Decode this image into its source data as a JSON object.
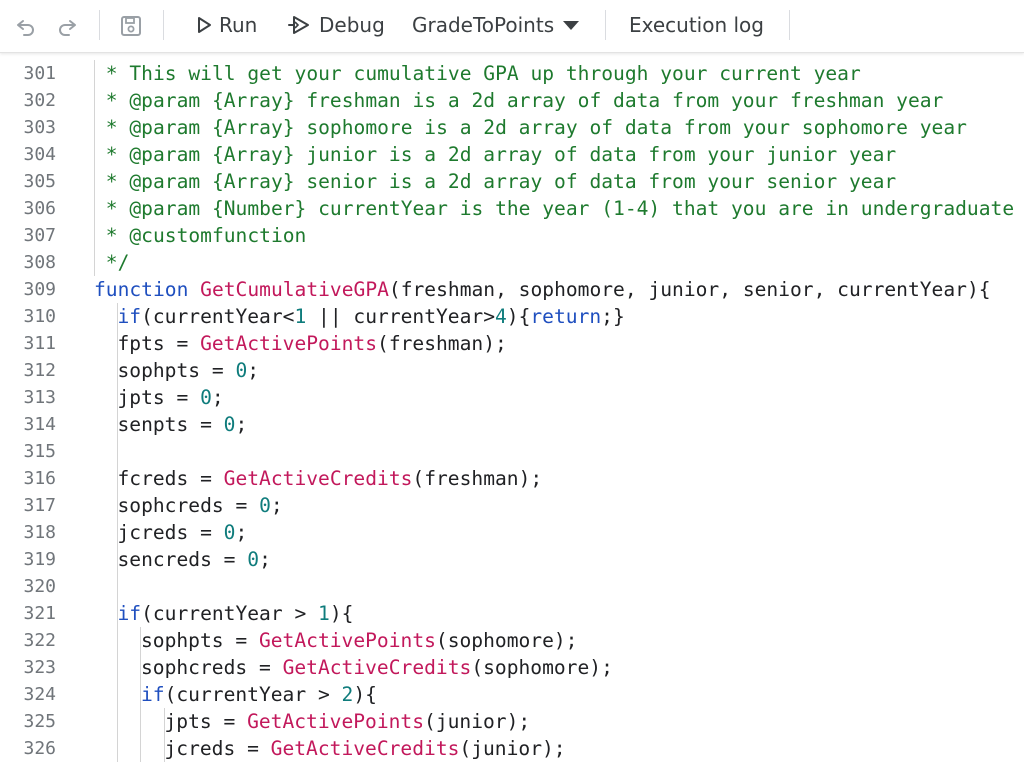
{
  "toolbar": {
    "undo_icon": "undo-icon",
    "redo_icon": "redo-icon",
    "save_icon": "save-icon",
    "run_label": "Run",
    "debug_label": "Debug",
    "function_select": "GradeToPoints",
    "execution_log_label": "Execution log"
  },
  "editor": {
    "lines": [
      {
        "n": "301",
        "indent": 0,
        "tokens": [
          {
            "t": " * This will get your cumulative GPA up through your current year",
            "c": "cmt"
          }
        ]
      },
      {
        "n": "302",
        "indent": 0,
        "tokens": [
          {
            "t": " * @param {Array} freshman is a 2d array of data from your freshman year",
            "c": "cmt"
          }
        ]
      },
      {
        "n": "303",
        "indent": 0,
        "tokens": [
          {
            "t": " * @param {Array} sophomore is a 2d array of data from your sophomore year",
            "c": "cmt"
          }
        ]
      },
      {
        "n": "304",
        "indent": 0,
        "tokens": [
          {
            "t": " * @param {Array} junior is a 2d array of data from your junior year",
            "c": "cmt"
          }
        ]
      },
      {
        "n": "305",
        "indent": 0,
        "tokens": [
          {
            "t": " * @param {Array} senior is a 2d array of data from your senior year",
            "c": "cmt"
          }
        ]
      },
      {
        "n": "306",
        "indent": 0,
        "tokens": [
          {
            "t": " * @param {Number} currentYear is the year (1-4) that you are in undergraduate",
            "c": "cmt"
          }
        ]
      },
      {
        "n": "307",
        "indent": 0,
        "tokens": [
          {
            "t": " * @customfunction",
            "c": "cmt"
          }
        ]
      },
      {
        "n": "308",
        "indent": 0,
        "tokens": [
          {
            "t": " */",
            "c": "cmt"
          }
        ]
      },
      {
        "n": "309",
        "indent": 0,
        "tokens": [
          {
            "t": "function",
            "c": "kw"
          },
          {
            "t": " "
          },
          {
            "t": "GetCumulativeGPA",
            "c": "fn"
          },
          {
            "t": "(freshman, sophomore, junior, senior, currentYear){"
          }
        ]
      },
      {
        "n": "310",
        "indent": 1,
        "tokens": [
          {
            "t": "if",
            "c": "kw"
          },
          {
            "t": "(currentYear<"
          },
          {
            "t": "1",
            "c": "num"
          },
          {
            "t": " || currentYear>"
          },
          {
            "t": "4",
            "c": "num"
          },
          {
            "t": "){"
          },
          {
            "t": "return",
            "c": "kw"
          },
          {
            "t": ";}"
          }
        ]
      },
      {
        "n": "311",
        "indent": 1,
        "tokens": [
          {
            "t": "fpts = "
          },
          {
            "t": "GetActivePoints",
            "c": "fn"
          },
          {
            "t": "(freshman);"
          }
        ]
      },
      {
        "n": "312",
        "indent": 1,
        "tokens": [
          {
            "t": "sophpts = "
          },
          {
            "t": "0",
            "c": "num"
          },
          {
            "t": ";"
          }
        ]
      },
      {
        "n": "313",
        "indent": 1,
        "tokens": [
          {
            "t": "jpts = "
          },
          {
            "t": "0",
            "c": "num"
          },
          {
            "t": ";"
          }
        ]
      },
      {
        "n": "314",
        "indent": 1,
        "tokens": [
          {
            "t": "senpts = "
          },
          {
            "t": "0",
            "c": "num"
          },
          {
            "t": ";"
          }
        ]
      },
      {
        "n": "315",
        "indent": 1,
        "tokens": []
      },
      {
        "n": "316",
        "indent": 1,
        "tokens": [
          {
            "t": "fcreds = "
          },
          {
            "t": "GetActiveCredits",
            "c": "fn"
          },
          {
            "t": "(freshman);"
          }
        ]
      },
      {
        "n": "317",
        "indent": 1,
        "tokens": [
          {
            "t": "sophcreds = "
          },
          {
            "t": "0",
            "c": "num"
          },
          {
            "t": ";"
          }
        ]
      },
      {
        "n": "318",
        "indent": 1,
        "tokens": [
          {
            "t": "jcreds = "
          },
          {
            "t": "0",
            "c": "num"
          },
          {
            "t": ";"
          }
        ]
      },
      {
        "n": "319",
        "indent": 1,
        "tokens": [
          {
            "t": "sencreds = "
          },
          {
            "t": "0",
            "c": "num"
          },
          {
            "t": ";"
          }
        ]
      },
      {
        "n": "320",
        "indent": 1,
        "tokens": []
      },
      {
        "n": "321",
        "indent": 1,
        "tokens": [
          {
            "t": "if",
            "c": "kw"
          },
          {
            "t": "(currentYear > "
          },
          {
            "t": "1",
            "c": "num"
          },
          {
            "t": "){"
          }
        ]
      },
      {
        "n": "322",
        "indent": 2,
        "tokens": [
          {
            "t": "sophpts = "
          },
          {
            "t": "GetActivePoints",
            "c": "fn"
          },
          {
            "t": "(sophomore);"
          }
        ]
      },
      {
        "n": "323",
        "indent": 2,
        "tokens": [
          {
            "t": "sophcreds = "
          },
          {
            "t": "GetActiveCredits",
            "c": "fn"
          },
          {
            "t": "(sophomore);"
          }
        ]
      },
      {
        "n": "324",
        "indent": 2,
        "tokens": [
          {
            "t": "if",
            "c": "kw"
          },
          {
            "t": "(currentYear > "
          },
          {
            "t": "2",
            "c": "num"
          },
          {
            "t": "){"
          }
        ]
      },
      {
        "n": "325",
        "indent": 3,
        "tokens": [
          {
            "t": "jpts = "
          },
          {
            "t": "GetActivePoints",
            "c": "fn"
          },
          {
            "t": "(junior);"
          }
        ]
      },
      {
        "n": "326",
        "indent": 3,
        "tokens": [
          {
            "t": "jcreds = "
          },
          {
            "t": "GetActiveCredits",
            "c": "fn"
          },
          {
            "t": "(junior);"
          }
        ]
      }
    ]
  }
}
